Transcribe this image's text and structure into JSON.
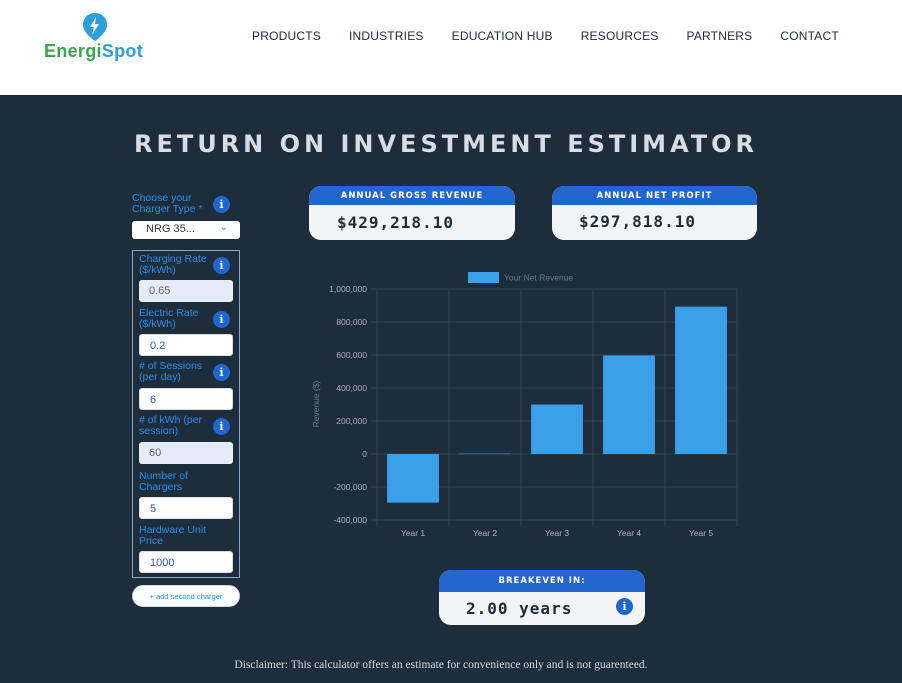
{
  "brand": {
    "prefix": "Energi",
    "suffix": "Spot"
  },
  "nav": [
    "PRODUCTS",
    "INDUSTRIES",
    "EDUCATION HUB",
    "RESOURCES",
    "PARTNERS",
    "CONTACT"
  ],
  "title": "RETURN ON INVESTMENT ESTIMATOR",
  "form": {
    "charger_type_label": "Choose your Charger Type *",
    "charger_type_value": "NRG 35...",
    "fields": [
      {
        "label": "Charging Rate ($/kWh)",
        "value": "0.65",
        "editable": false,
        "info": true
      },
      {
        "label": "Electric Rate ($/kWh)",
        "value": "0.2",
        "editable": true,
        "info": true
      },
      {
        "label": "# of Sessions (per day)",
        "value": "6",
        "editable": true,
        "info": true
      },
      {
        "label": "# of kWh (per session)",
        "value": "60",
        "editable": false,
        "info": true
      },
      {
        "label": "Number of Chargers",
        "value": "5",
        "editable": true,
        "info": false
      },
      {
        "label": "Hardware Unit Price",
        "value": "1000",
        "editable": true,
        "info": false
      }
    ],
    "add_button": "+ add second charger",
    "info_glyph": "i"
  },
  "cards": {
    "gross": {
      "label": "ANNUAL GROSS REVENUE",
      "value": "$429,218.10"
    },
    "profit": {
      "label": "ANNUAL NET PROFIT",
      "value": "$297,818.10"
    },
    "breakeven": {
      "label": "BREAKEVEN IN:",
      "value": "2.00 years"
    }
  },
  "chart_data": {
    "type": "bar",
    "categories": [
      "Year 1",
      "Year 2",
      "Year 3",
      "Year 4",
      "Year 5"
    ],
    "series": [
      {
        "name": "Your Net Revenue",
        "values": [
          -295000,
          2000,
          300000,
          597000,
          893000
        ]
      }
    ],
    "ylabel": "Revenue ($)",
    "ylim": [
      -400000,
      1000000
    ],
    "yticks": [
      "1,000,000",
      "800,000",
      "600,000",
      "400,000",
      "200,000",
      "0",
      "-200,000",
      "-400,000"
    ],
    "grid": true,
    "legend": "top",
    "bar_color": "#3aa0ea"
  },
  "disclaimer": "Disclaimer: This calculator offers an estimate for convenience only and is not guarenteed."
}
